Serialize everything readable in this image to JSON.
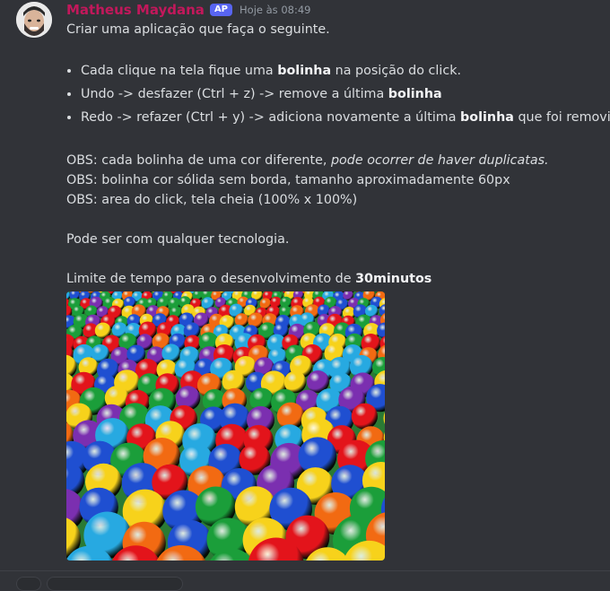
{
  "message": {
    "author": "Matheus Maydana",
    "badge": "AP",
    "timestamp": "Hoje às 08:49",
    "intro": "Criar uma aplicação que faça o seguinte.",
    "bullets": [
      {
        "pre": "Cada clique na tela fique uma ",
        "bold": "bolinha",
        "post": " na posição do click."
      },
      {
        "pre": "Undo -> desfazer (Ctrl + z) -> remove a última ",
        "bold": "bolinha",
        "post": ""
      },
      {
        "pre": "Redo -> refazer (Ctrl + y) -> adiciona novamente a última ",
        "bold": "bolinha",
        "post": " que foi removida"
      }
    ],
    "obs1_pre": "OBS: cada bolinha de uma cor diferente, ",
    "obs1_italic": "pode ocorrer de haver duplicatas.",
    "obs2": "OBS: bolinha cor sólida sem borda, tamanho aproximadamente 60px",
    "obs3": "OBS: area do click, tela cheia (100% x 100%)",
    "tech": "Pode ser com qualquer tecnologia.",
    "limit_pre": "Limite de tempo para o desenvolvimento de ",
    "limit_bold": "30minutos"
  },
  "colors": {
    "username": "#c2185b",
    "background": "#313338",
    "badge": "#5865f2"
  },
  "icons": {
    "avatar": "user-avatar",
    "attachment": "ball-pit-image"
  }
}
